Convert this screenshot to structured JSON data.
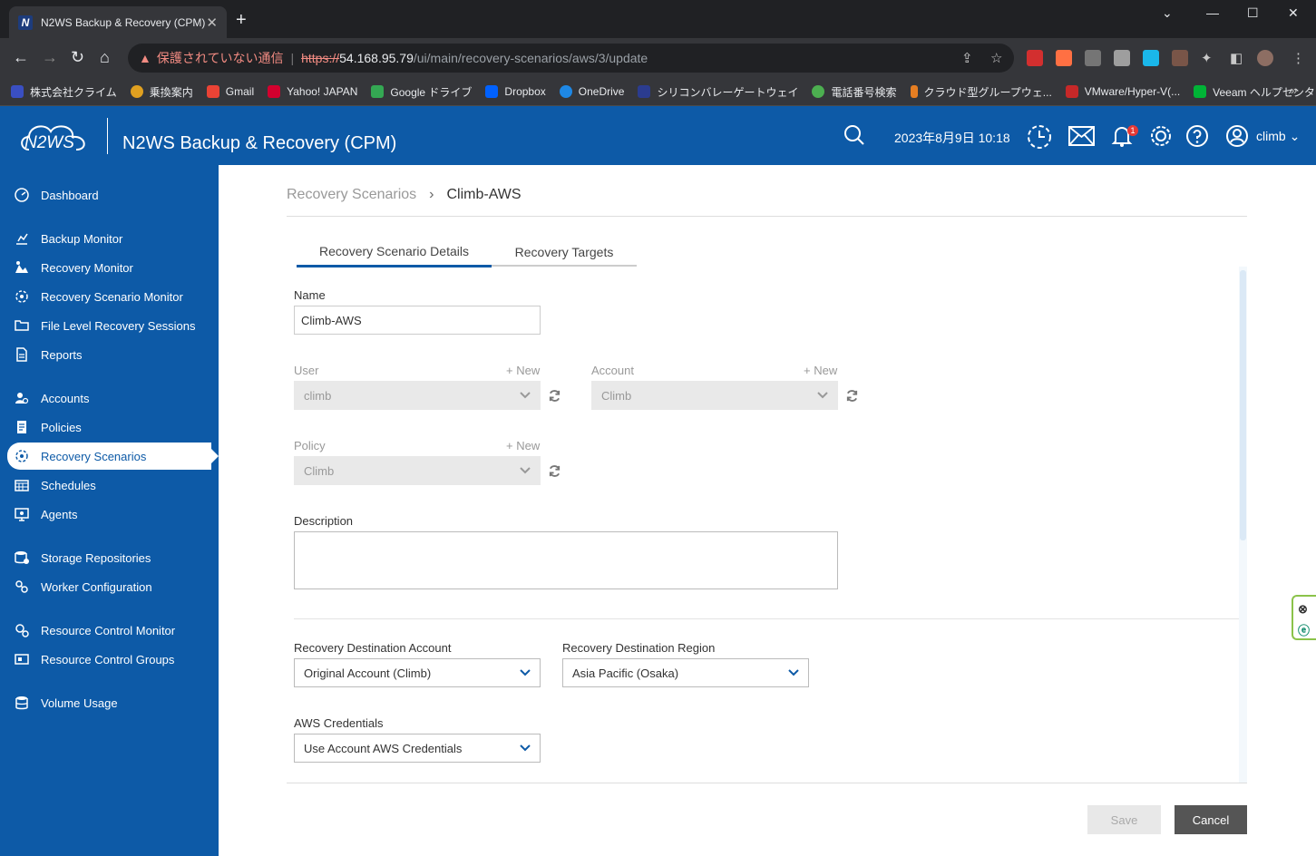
{
  "browser": {
    "tab_title": "N2WS Backup & Recovery (CPM)",
    "tab_favicon": "N",
    "security_label": "保護されていない通信",
    "url_scheme": "https://",
    "url_host": "54.168.95.79",
    "url_path": "/ui/main/recovery-scenarios/aws/3/update",
    "bookmarks": [
      {
        "label": "株式会社クライム",
        "color": "#3a4fc2"
      },
      {
        "label": "乗換案内",
        "color": "#e0a020"
      },
      {
        "label": "Gmail",
        "color": "#ea4335"
      },
      {
        "label": "Yahoo! JAPAN",
        "color": "#d3002e"
      },
      {
        "label": "Google ドライブ",
        "color": "#34a853"
      },
      {
        "label": "Dropbox",
        "color": "#0061fe"
      },
      {
        "label": "OneDrive",
        "color": "#1e88e5"
      },
      {
        "label": "シリコンバレーゲートウェイ",
        "color": "#2b3c8f"
      },
      {
        "label": "電話番号検索",
        "color": "#4caf50"
      },
      {
        "label": "クラウド型グループウェ...",
        "color": "#e67e22"
      },
      {
        "label": "VMware/Hyper-V(...",
        "color": "#c62828"
      },
      {
        "label": "Veeam ヘルプセンター...",
        "color": "#00b336"
      }
    ]
  },
  "header": {
    "logo_text": "N2WS",
    "title": "N2WS Backup & Recovery (CPM)",
    "datetime": "2023年8月9日 10:18",
    "notification_count": "1",
    "username": "climb"
  },
  "sidebar": {
    "items": [
      {
        "label": "Dashboard",
        "icon": "dashboard-icon"
      },
      {
        "label": "Backup Monitor",
        "icon": "backup-monitor-icon"
      },
      {
        "label": "Recovery Monitor",
        "icon": "recovery-monitor-icon"
      },
      {
        "label": "Recovery Scenario Monitor",
        "icon": "scenario-monitor-icon"
      },
      {
        "label": "File Level Recovery Sessions",
        "icon": "folder-icon"
      },
      {
        "label": "Reports",
        "icon": "report-icon"
      },
      {
        "label": "Accounts",
        "icon": "accounts-icon"
      },
      {
        "label": "Policies",
        "icon": "policies-icon"
      },
      {
        "label": "Recovery Scenarios",
        "icon": "scenario-icon"
      },
      {
        "label": "Schedules",
        "icon": "calendar-icon"
      },
      {
        "label": "Agents",
        "icon": "agent-icon"
      },
      {
        "label": "Storage Repositories",
        "icon": "storage-icon"
      },
      {
        "label": "Worker Configuration",
        "icon": "worker-icon"
      },
      {
        "label": "Resource Control Monitor",
        "icon": "resource-monitor-icon"
      },
      {
        "label": "Resource Control Groups",
        "icon": "resource-groups-icon"
      },
      {
        "label": "Volume Usage",
        "icon": "database-icon"
      }
    ]
  },
  "main": {
    "breadcrumb": {
      "parent": "Recovery Scenarios",
      "current": "Climb-AWS"
    },
    "tabs": [
      "Recovery Scenario Details",
      "Recovery Targets"
    ],
    "form": {
      "name_label": "Name",
      "name_value": "Climb-AWS",
      "user_label": "User",
      "user_value": "climb",
      "account_label": "Account",
      "account_value": "Climb",
      "policy_label": "Policy",
      "policy_value": "Climb",
      "new_link": "+ New",
      "description_label": "Description",
      "description_value": "",
      "dest_account_label": "Recovery Destination Account",
      "dest_account_value": "Original Account (Climb)",
      "dest_region_label": "Recovery Destination Region",
      "dest_region_value": "Asia Pacific (Osaka)",
      "aws_cred_label": "AWS Credentials",
      "aws_cred_value": "Use Account AWS Credentials"
    },
    "buttons": {
      "save": "Save",
      "cancel": "Cancel"
    }
  },
  "colors": {
    "brand": "#0d5aa7",
    "chrome_dark": "#202124",
    "chrome_mid": "#35363a"
  }
}
